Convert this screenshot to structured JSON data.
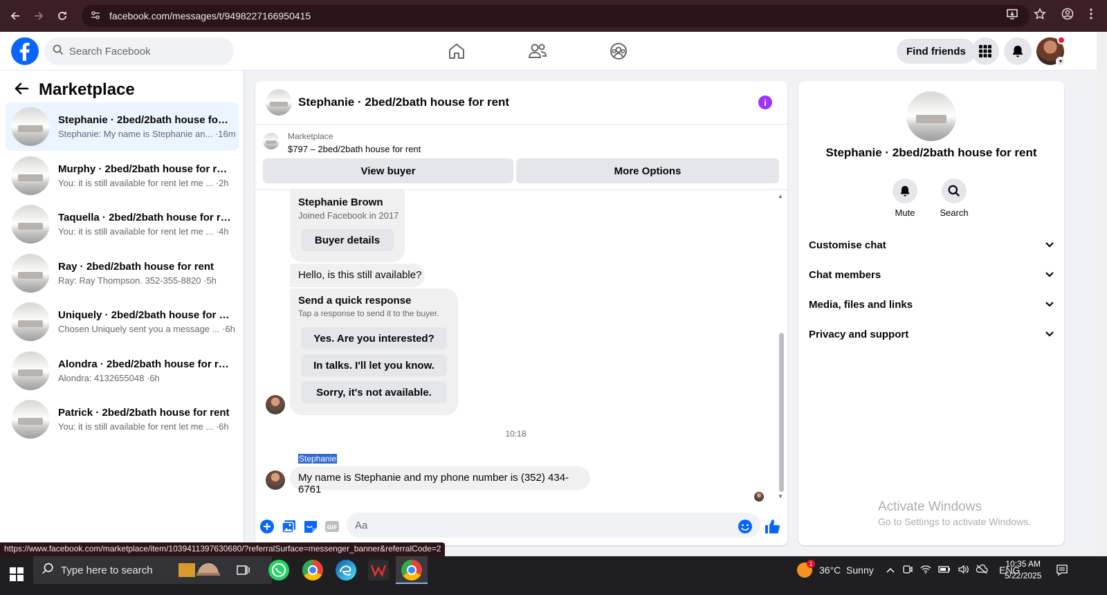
{
  "browser": {
    "url": "facebook.com/messages/t/9498227166950415",
    "status_url": "https://www.facebook.com/marketplace/item/1039411397630680/?referralSurface=messenger_banner&referralCode=2"
  },
  "header": {
    "search_placeholder": "Search Facebook",
    "find_friends": "Find friends"
  },
  "sidebar": {
    "title": "Marketplace",
    "conversations": [
      {
        "name": "Stephanie · 2bed/2bath house for ...",
        "preview": "Stephanie: My name is Stephanie an... ·16m"
      },
      {
        "name": "Murphy · 2bed/2bath house for rent",
        "preview": "You: it is still available for rent let me ... ·2h"
      },
      {
        "name": "Taquella · 2bed/2bath house for re...",
        "preview": "You: it is still available for rent let me ... ·4h"
      },
      {
        "name": "Ray · 2bed/2bath house for rent",
        "preview": "Ray: Ray Thompson. 352-355-8820 ·5h"
      },
      {
        "name": "Uniquely · 2bed/2bath house for r...",
        "preview": "Chosen Uniquely sent you a message ... ·6h"
      },
      {
        "name": "Alondra · 2bed/2bath house for rent",
        "preview": "Alondra: 4132655048 ·6h"
      },
      {
        "name": "Patrick · 2bed/2bath house for rent",
        "preview": "You: it is still available for rent let me ... ·6h"
      }
    ]
  },
  "chat": {
    "title": "Stephanie · 2bed/2bath house for rent",
    "banner_label": "Marketplace",
    "banner_price": "$797 – 2bed/2bath house for rent",
    "view_buyer": "View buyer",
    "more_options": "More Options",
    "buyer_name": "Stephanie Brown",
    "buyer_joined": "Joined Facebook in 2017",
    "buyer_details": "Buyer details",
    "msg1": "Hello, is this still available?",
    "quick_title": "Send a quick response",
    "quick_sub": "Tap a response to send it to the buyer.",
    "quick_responses": [
      "Yes. Are you interested?",
      "In talks. I'll let you know.",
      "Sorry, it's not available."
    ],
    "timestamp": "10:18",
    "sender": "Stephanie",
    "msg2": "My name is Stephanie and my phone number is (352) 434-6761",
    "composer_placeholder": "Aa"
  },
  "right_panel": {
    "title": "Stephanie · 2bed/2bath house for rent",
    "mute": "Mute",
    "search": "Search",
    "sections": [
      "Customise chat",
      "Chat members",
      "Media, files and links",
      "Privacy and support"
    ]
  },
  "watermark": {
    "line1": "Activate Windows",
    "line2": "Go to Settings to activate Windows."
  },
  "taskbar": {
    "search_placeholder": "Type here to search",
    "weather": "36°C  Sunny",
    "weather_badge": "1",
    "lang": "ENG",
    "time": "10:35 AM",
    "date": "5/22/2025"
  }
}
